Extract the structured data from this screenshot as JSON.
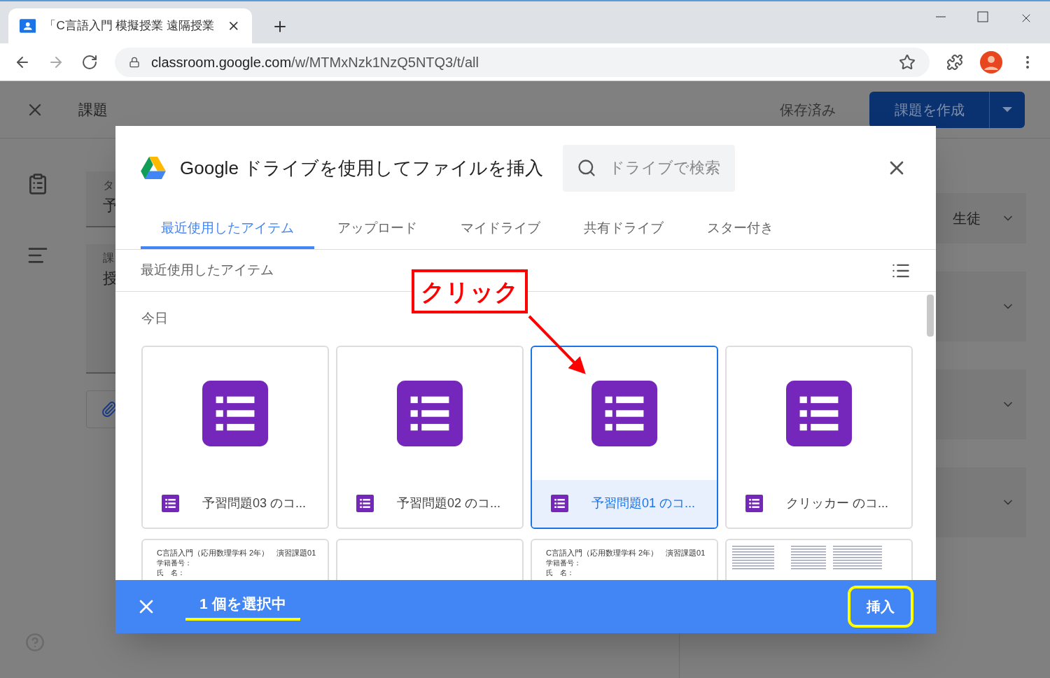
{
  "browser": {
    "tab_title": "「C言語入門 模擬授業 遠隔授業",
    "url_host": "classroom.google.com",
    "url_path": "/w/MTMxNzk1NzQ5NTQ3/t/all"
  },
  "page": {
    "title": "課題",
    "saved": "保存済み",
    "create_button": "課題を作成",
    "left_fields": [
      {
        "label": "タ",
        "value": "予"
      },
      {
        "label": "課",
        "value": "授"
      }
    ],
    "right_field": "生徒"
  },
  "dialog": {
    "title": "Google ドライブを使用してファイルを挿入",
    "search": {
      "placeholder": "ドライブで検索"
    },
    "tabs": [
      {
        "label": "最近使用したアイテム",
        "selected": true
      },
      {
        "label": "アップロード",
        "selected": false
      },
      {
        "label": "マイドライブ",
        "selected": false
      },
      {
        "label": "共有ドライブ",
        "selected": false
      },
      {
        "label": "スター付き",
        "selected": false
      }
    ],
    "section_title": "最近使用したアイテム",
    "group_label": "今日",
    "files": [
      {
        "name": "予習問題03 のコ...",
        "selected": false
      },
      {
        "name": "予習問題02 のコ...",
        "selected": false
      },
      {
        "name": "予習問題01 のコ...",
        "selected": true
      },
      {
        "name": "クリッカー のコ...",
        "selected": false
      }
    ],
    "thumbnails": [
      {
        "kind": "document",
        "heading": "C言語入門（応用数理学科 2年）　演習課題01",
        "lines": [
          "学籍番号：",
          "氏　名："
        ]
      },
      {
        "kind": "blank"
      },
      {
        "kind": "document",
        "heading": "C言語入門（応用数理学科 2年）　演習課題01",
        "lines": [
          "学籍番号：",
          "氏　名："
        ]
      },
      {
        "kind": "sheet"
      }
    ],
    "footer": {
      "selection": "1 個を選択中",
      "insert_button": "挿入"
    }
  },
  "annotation": {
    "callout": "クリック"
  }
}
